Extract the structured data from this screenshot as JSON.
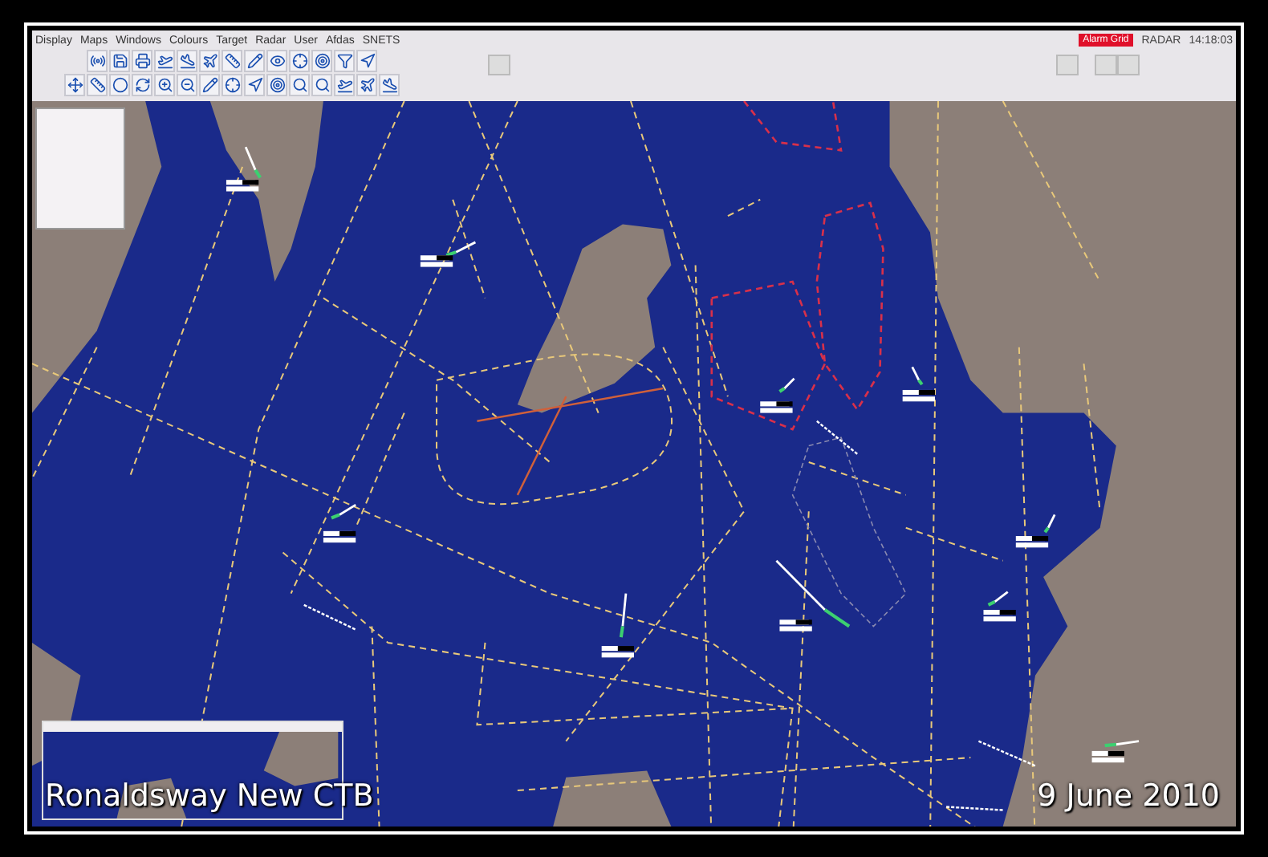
{
  "menu": [
    {
      "label": "Display"
    },
    {
      "label": "Maps"
    },
    {
      "label": "Windows"
    },
    {
      "label": "Colours"
    },
    {
      "label": "Target"
    },
    {
      "label": "Radar"
    },
    {
      "label": "User"
    },
    {
      "label": "Afdas"
    },
    {
      "label": "SNETS"
    }
  ],
  "status": {
    "alarm": "Alarm Grid",
    "mode": "RADAR",
    "time": "14:18:03"
  },
  "captions": {
    "title": "Ronaldsway New CTB",
    "date": "9 June 2010"
  }
}
